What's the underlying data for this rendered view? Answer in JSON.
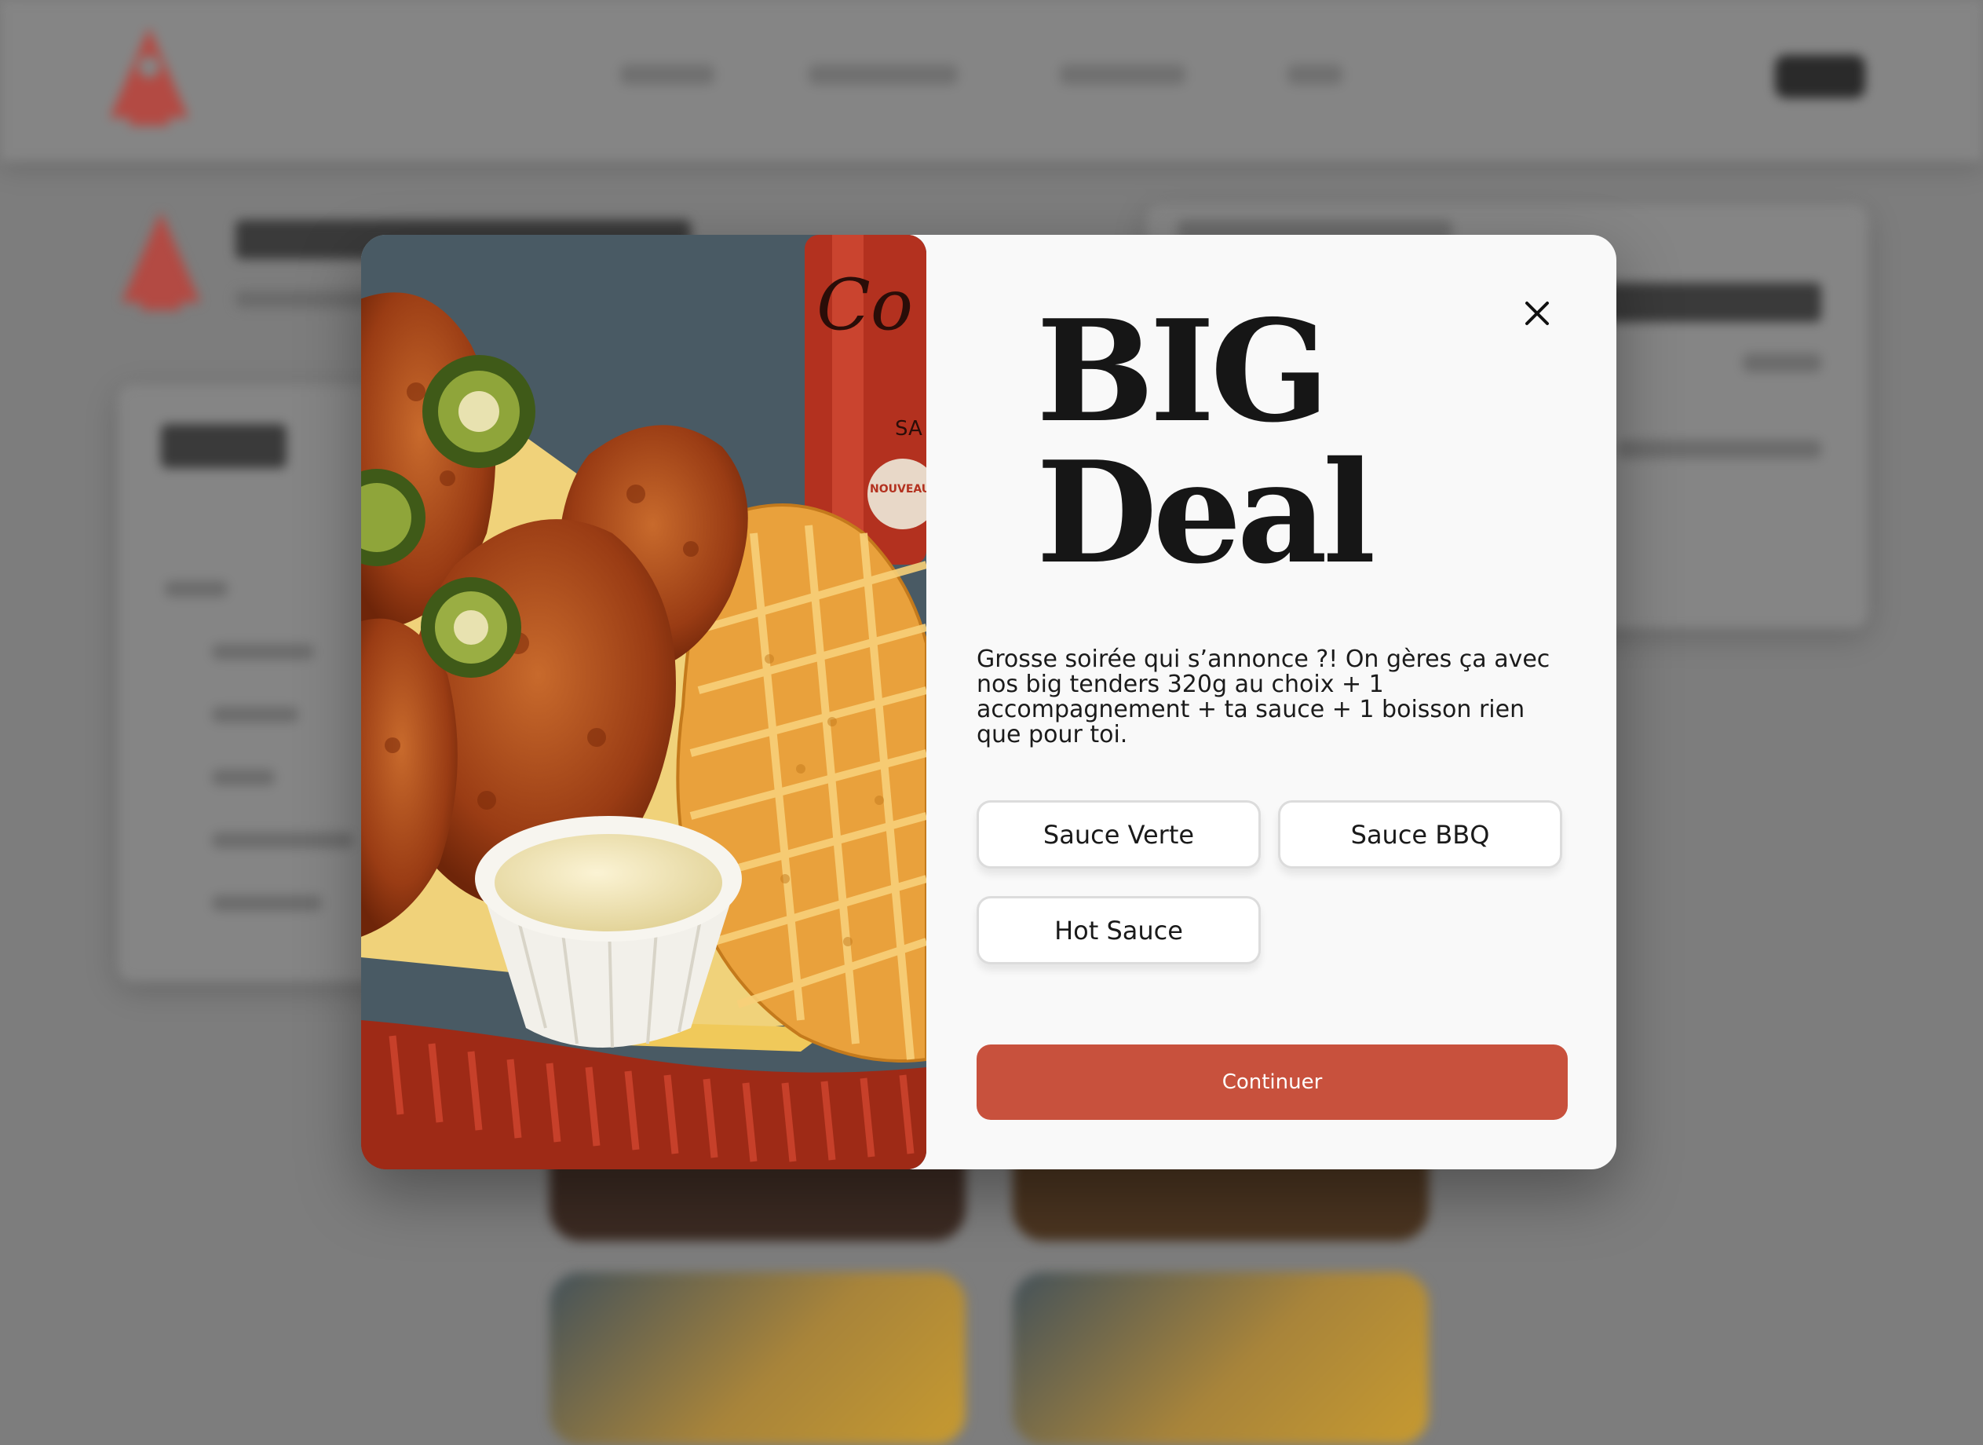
{
  "modal": {
    "title_line1": "BIG",
    "title_line2": "Deal",
    "description": "Grosse soirée qui s’annonce ?! On gères ça avec nos big tenders 320g au choix + 1 accompagnement + ta sauce + 1 boisson rien que pour toi.",
    "options": [
      {
        "label": "Sauce Verte"
      },
      {
        "label": "Sauce BBQ"
      },
      {
        "label": "Hot Sauce"
      }
    ],
    "continue_label": "Continuer",
    "close_icon": "close-icon",
    "image_icon": "food-photo",
    "can_text": "NOUVEAU GOÛT"
  },
  "colors": {
    "accent": "#c8513d",
    "brand": "#c8453a",
    "backdrop": "#7d7d7d"
  }
}
